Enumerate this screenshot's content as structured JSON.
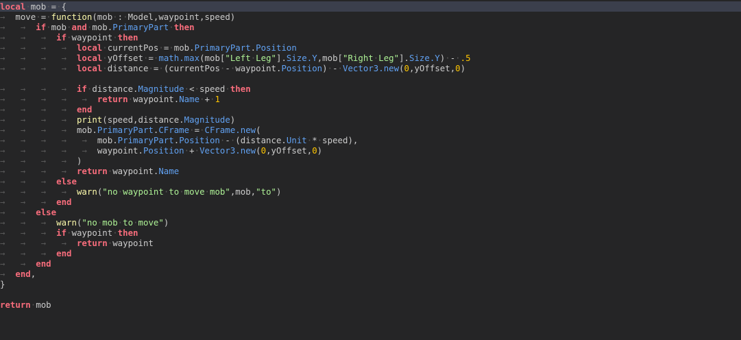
{
  "editor": {
    "lines": [
      [
        [
          "kw",
          "local"
        ],
        [
          "ws",
          "·"
        ],
        [
          "id",
          "mob"
        ],
        [
          "ws",
          "·"
        ],
        [
          "op",
          "="
        ],
        [
          "ws",
          "·"
        ],
        [
          "op",
          "{"
        ]
      ],
      [
        [
          "tab",
          "→"
        ],
        [
          "pad",
          "  "
        ],
        [
          "id",
          "move"
        ],
        [
          "ws",
          "·"
        ],
        [
          "op",
          "="
        ],
        [
          "ws",
          "·"
        ],
        [
          "fn",
          "function"
        ],
        [
          "op",
          "(mob"
        ],
        [
          "ws",
          "·"
        ],
        [
          "op",
          ":"
        ],
        [
          "ws",
          "·"
        ],
        [
          "id",
          "Model,waypoint,speed)"
        ]
      ],
      [
        [
          "tab",
          "→"
        ],
        [
          "pad",
          "   "
        ],
        [
          "tab",
          "→"
        ],
        [
          "pad",
          "  "
        ],
        [
          "kw",
          "if"
        ],
        [
          "ws",
          "·"
        ],
        [
          "id",
          "mob"
        ],
        [
          "ws",
          "·"
        ],
        [
          "kw",
          "and"
        ],
        [
          "ws",
          "·"
        ],
        [
          "id",
          "mob."
        ],
        [
          "prop",
          "PrimaryPart"
        ],
        [
          "ws",
          "·"
        ],
        [
          "kw",
          "then"
        ]
      ],
      [
        [
          "tab",
          "→"
        ],
        [
          "pad",
          "   "
        ],
        [
          "tab",
          "→"
        ],
        [
          "pad",
          "   "
        ],
        [
          "tab",
          "→"
        ],
        [
          "pad",
          "  "
        ],
        [
          "kw",
          "if"
        ],
        [
          "ws",
          "·"
        ],
        [
          "id",
          "waypoint"
        ],
        [
          "ws",
          "·"
        ],
        [
          "kw",
          "then"
        ]
      ],
      [
        [
          "tab",
          "→"
        ],
        [
          "pad",
          "   "
        ],
        [
          "tab",
          "→"
        ],
        [
          "pad",
          "   "
        ],
        [
          "tab",
          "→"
        ],
        [
          "pad",
          "   "
        ],
        [
          "tab",
          "→"
        ],
        [
          "pad",
          "  "
        ],
        [
          "kw",
          "local"
        ],
        [
          "ws",
          "·"
        ],
        [
          "id",
          "currentPos"
        ],
        [
          "ws",
          "·"
        ],
        [
          "op",
          "="
        ],
        [
          "ws",
          "·"
        ],
        [
          "id",
          "mob."
        ],
        [
          "prop",
          "PrimaryPart"
        ],
        [
          "id",
          "."
        ],
        [
          "prop",
          "Position"
        ]
      ],
      [
        [
          "tab",
          "→"
        ],
        [
          "pad",
          "   "
        ],
        [
          "tab",
          "→"
        ],
        [
          "pad",
          "   "
        ],
        [
          "tab",
          "→"
        ],
        [
          "pad",
          "   "
        ],
        [
          "tab",
          "→"
        ],
        [
          "pad",
          "  "
        ],
        [
          "kw",
          "local"
        ],
        [
          "ws",
          "·"
        ],
        [
          "id",
          "yOffset"
        ],
        [
          "ws",
          "·"
        ],
        [
          "op",
          "="
        ],
        [
          "ws",
          "·"
        ],
        [
          "prop",
          "math.max"
        ],
        [
          "id",
          "(mob["
        ],
        [
          "str",
          "\"Left"
        ],
        [
          "ws",
          "·"
        ],
        [
          "str",
          "Leg\""
        ],
        [
          "id",
          "]."
        ],
        [
          "prop",
          "Size.Y"
        ],
        [
          "id",
          ",mob["
        ],
        [
          "str",
          "\"Right"
        ],
        [
          "ws",
          "·"
        ],
        [
          "str",
          "Leg\""
        ],
        [
          "id",
          "]."
        ],
        [
          "prop",
          "Size.Y"
        ],
        [
          "id",
          ")"
        ],
        [
          "ws",
          "·"
        ],
        [
          "op",
          "-"
        ],
        [
          "ws",
          "·"
        ],
        [
          "num",
          ".5"
        ]
      ],
      [
        [
          "tab",
          "→"
        ],
        [
          "pad",
          "   "
        ],
        [
          "tab",
          "→"
        ],
        [
          "pad",
          "   "
        ],
        [
          "tab",
          "→"
        ],
        [
          "pad",
          "   "
        ],
        [
          "tab",
          "→"
        ],
        [
          "pad",
          "  "
        ],
        [
          "kw",
          "local"
        ],
        [
          "ws",
          "·"
        ],
        [
          "id",
          "distance"
        ],
        [
          "ws",
          "·"
        ],
        [
          "op",
          "="
        ],
        [
          "ws",
          "·"
        ],
        [
          "id",
          "(currentPos"
        ],
        [
          "ws",
          "·"
        ],
        [
          "op",
          "-"
        ],
        [
          "ws",
          "·"
        ],
        [
          "id",
          "waypoint."
        ],
        [
          "prop",
          "Position"
        ],
        [
          "id",
          ")"
        ],
        [
          "ws",
          "·"
        ],
        [
          "op",
          "-"
        ],
        [
          "ws",
          "·"
        ],
        [
          "prop",
          "Vector3.new"
        ],
        [
          "id",
          "("
        ],
        [
          "num",
          "0"
        ],
        [
          "id",
          ",yOffset,"
        ],
        [
          "num",
          "0"
        ],
        [
          "id",
          ")"
        ]
      ],
      [],
      [
        [
          "tab",
          "→"
        ],
        [
          "pad",
          "   "
        ],
        [
          "tab",
          "→"
        ],
        [
          "pad",
          "   "
        ],
        [
          "tab",
          "→"
        ],
        [
          "pad",
          "   "
        ],
        [
          "tab",
          "→"
        ],
        [
          "pad",
          "  "
        ],
        [
          "kw",
          "if"
        ],
        [
          "ws",
          "·"
        ],
        [
          "id",
          "distance."
        ],
        [
          "prop",
          "Magnitude"
        ],
        [
          "ws",
          "·"
        ],
        [
          "op",
          "<"
        ],
        [
          "ws",
          "·"
        ],
        [
          "id",
          "speed"
        ],
        [
          "ws",
          "·"
        ],
        [
          "kw",
          "then"
        ]
      ],
      [
        [
          "tab",
          "→"
        ],
        [
          "pad",
          "   "
        ],
        [
          "tab",
          "→"
        ],
        [
          "pad",
          "   "
        ],
        [
          "tab",
          "→"
        ],
        [
          "pad",
          "   "
        ],
        [
          "tab",
          "→"
        ],
        [
          "pad",
          "   "
        ],
        [
          "tab",
          "→"
        ],
        [
          "pad",
          "  "
        ],
        [
          "kw",
          "return"
        ],
        [
          "ws",
          "·"
        ],
        [
          "id",
          "waypoint."
        ],
        [
          "prop",
          "Name"
        ],
        [
          "ws",
          "·"
        ],
        [
          "op",
          "+"
        ],
        [
          "ws",
          "·"
        ],
        [
          "num",
          "1"
        ]
      ],
      [
        [
          "tab",
          "→"
        ],
        [
          "pad",
          "   "
        ],
        [
          "tab",
          "→"
        ],
        [
          "pad",
          "   "
        ],
        [
          "tab",
          "→"
        ],
        [
          "pad",
          "   "
        ],
        [
          "tab",
          "→"
        ],
        [
          "pad",
          "  "
        ],
        [
          "kw",
          "end"
        ]
      ],
      [
        [
          "tab",
          "→"
        ],
        [
          "pad",
          "   "
        ],
        [
          "tab",
          "→"
        ],
        [
          "pad",
          "   "
        ],
        [
          "tab",
          "→"
        ],
        [
          "pad",
          "   "
        ],
        [
          "tab",
          "→"
        ],
        [
          "pad",
          "  "
        ],
        [
          "fn",
          "print"
        ],
        [
          "id",
          "(speed,distance."
        ],
        [
          "prop",
          "Magnitude"
        ],
        [
          "id",
          ")"
        ]
      ],
      [
        [
          "tab",
          "→"
        ],
        [
          "pad",
          "   "
        ],
        [
          "tab",
          "→"
        ],
        [
          "pad",
          "   "
        ],
        [
          "tab",
          "→"
        ],
        [
          "pad",
          "   "
        ],
        [
          "tab",
          "→"
        ],
        [
          "pad",
          "  "
        ],
        [
          "id",
          "mob."
        ],
        [
          "prop",
          "PrimaryPart"
        ],
        [
          "id",
          "."
        ],
        [
          "prop",
          "CFrame"
        ],
        [
          "ws",
          "·"
        ],
        [
          "op",
          "="
        ],
        [
          "ws",
          "·"
        ],
        [
          "prop",
          "CFrame.new"
        ],
        [
          "id",
          "("
        ]
      ],
      [
        [
          "tab",
          "→"
        ],
        [
          "pad",
          "   "
        ],
        [
          "tab",
          "→"
        ],
        [
          "pad",
          "   "
        ],
        [
          "tab",
          "→"
        ],
        [
          "pad",
          "   "
        ],
        [
          "tab",
          "→"
        ],
        [
          "pad",
          "   "
        ],
        [
          "tab",
          "→"
        ],
        [
          "pad",
          "  "
        ],
        [
          "id",
          "mob."
        ],
        [
          "prop",
          "PrimaryPart"
        ],
        [
          "id",
          "."
        ],
        [
          "prop",
          "Position"
        ],
        [
          "ws",
          "·"
        ],
        [
          "op",
          "-"
        ],
        [
          "ws",
          "·"
        ],
        [
          "id",
          "(distance."
        ],
        [
          "prop",
          "Unit"
        ],
        [
          "ws",
          "·"
        ],
        [
          "op",
          "*"
        ],
        [
          "ws",
          "·"
        ],
        [
          "id",
          "speed),"
        ]
      ],
      [
        [
          "tab",
          "→"
        ],
        [
          "pad",
          "   "
        ],
        [
          "tab",
          "→"
        ],
        [
          "pad",
          "   "
        ],
        [
          "tab",
          "→"
        ],
        [
          "pad",
          "   "
        ],
        [
          "tab",
          "→"
        ],
        [
          "pad",
          "   "
        ],
        [
          "tab",
          "→"
        ],
        [
          "pad",
          "  "
        ],
        [
          "id",
          "waypoint."
        ],
        [
          "prop",
          "Position"
        ],
        [
          "ws",
          "·"
        ],
        [
          "op",
          "+"
        ],
        [
          "ws",
          "·"
        ],
        [
          "prop",
          "Vector3.new"
        ],
        [
          "id",
          "("
        ],
        [
          "num",
          "0"
        ],
        [
          "id",
          ",yOffset,"
        ],
        [
          "num",
          "0"
        ],
        [
          "id",
          ")"
        ]
      ],
      [
        [
          "tab",
          "→"
        ],
        [
          "pad",
          "   "
        ],
        [
          "tab",
          "→"
        ],
        [
          "pad",
          "   "
        ],
        [
          "tab",
          "→"
        ],
        [
          "pad",
          "   "
        ],
        [
          "tab",
          "→"
        ],
        [
          "pad",
          "  "
        ],
        [
          "id",
          ")"
        ]
      ],
      [
        [
          "tab",
          "→"
        ],
        [
          "pad",
          "   "
        ],
        [
          "tab",
          "→"
        ],
        [
          "pad",
          "   "
        ],
        [
          "tab",
          "→"
        ],
        [
          "pad",
          "   "
        ],
        [
          "tab",
          "→"
        ],
        [
          "pad",
          "  "
        ],
        [
          "kw",
          "return"
        ],
        [
          "ws",
          "·"
        ],
        [
          "id",
          "waypoint."
        ],
        [
          "prop",
          "Name"
        ]
      ],
      [
        [
          "tab",
          "→"
        ],
        [
          "pad",
          "   "
        ],
        [
          "tab",
          "→"
        ],
        [
          "pad",
          "   "
        ],
        [
          "tab",
          "→"
        ],
        [
          "pad",
          "  "
        ],
        [
          "kw",
          "else"
        ]
      ],
      [
        [
          "tab",
          "→"
        ],
        [
          "pad",
          "   "
        ],
        [
          "tab",
          "→"
        ],
        [
          "pad",
          "   "
        ],
        [
          "tab",
          "→"
        ],
        [
          "pad",
          "   "
        ],
        [
          "tab",
          "→"
        ],
        [
          "pad",
          "  "
        ],
        [
          "fn",
          "warn"
        ],
        [
          "id",
          "("
        ],
        [
          "str",
          "\"no"
        ],
        [
          "ws",
          "·"
        ],
        [
          "str",
          "waypoint"
        ],
        [
          "ws",
          "·"
        ],
        [
          "str",
          "to"
        ],
        [
          "ws",
          "·"
        ],
        [
          "str",
          "move"
        ],
        [
          "ws",
          "·"
        ],
        [
          "str",
          "mob\""
        ],
        [
          "id",
          ",mob,"
        ],
        [
          "str",
          "\"to\""
        ],
        [
          "id",
          ")"
        ]
      ],
      [
        [
          "tab",
          "→"
        ],
        [
          "pad",
          "   "
        ],
        [
          "tab",
          "→"
        ],
        [
          "pad",
          "   "
        ],
        [
          "tab",
          "→"
        ],
        [
          "pad",
          "  "
        ],
        [
          "kw",
          "end"
        ]
      ],
      [
        [
          "tab",
          "→"
        ],
        [
          "pad",
          "   "
        ],
        [
          "tab",
          "→"
        ],
        [
          "pad",
          "  "
        ],
        [
          "kw",
          "else"
        ]
      ],
      [
        [
          "tab",
          "→"
        ],
        [
          "pad",
          "   "
        ],
        [
          "tab",
          "→"
        ],
        [
          "pad",
          "   "
        ],
        [
          "tab",
          "→"
        ],
        [
          "pad",
          "  "
        ],
        [
          "fn",
          "warn"
        ],
        [
          "id",
          "("
        ],
        [
          "str",
          "\"no"
        ],
        [
          "ws",
          "·"
        ],
        [
          "str",
          "mob"
        ],
        [
          "ws",
          "·"
        ],
        [
          "str",
          "to"
        ],
        [
          "ws",
          "·"
        ],
        [
          "str",
          "move\""
        ],
        [
          "id",
          ")"
        ]
      ],
      [
        [
          "tab",
          "→"
        ],
        [
          "pad",
          "   "
        ],
        [
          "tab",
          "→"
        ],
        [
          "pad",
          "   "
        ],
        [
          "tab",
          "→"
        ],
        [
          "pad",
          "  "
        ],
        [
          "kw",
          "if"
        ],
        [
          "ws",
          "·"
        ],
        [
          "id",
          "waypoint"
        ],
        [
          "ws",
          "·"
        ],
        [
          "kw",
          "then"
        ]
      ],
      [
        [
          "tab",
          "→"
        ],
        [
          "pad",
          "   "
        ],
        [
          "tab",
          "→"
        ],
        [
          "pad",
          "   "
        ],
        [
          "tab",
          "→"
        ],
        [
          "pad",
          "   "
        ],
        [
          "tab",
          "→"
        ],
        [
          "pad",
          "  "
        ],
        [
          "kw",
          "return"
        ],
        [
          "ws",
          "·"
        ],
        [
          "id",
          "waypoint"
        ]
      ],
      [
        [
          "tab",
          "→"
        ],
        [
          "pad",
          "   "
        ],
        [
          "tab",
          "→"
        ],
        [
          "pad",
          "   "
        ],
        [
          "tab",
          "→"
        ],
        [
          "pad",
          "  "
        ],
        [
          "kw",
          "end"
        ]
      ],
      [
        [
          "tab",
          "→"
        ],
        [
          "pad",
          "   "
        ],
        [
          "tab",
          "→"
        ],
        [
          "pad",
          "  "
        ],
        [
          "kw",
          "end"
        ]
      ],
      [
        [
          "tab",
          "→"
        ],
        [
          "pad",
          "  "
        ],
        [
          "kw",
          "end"
        ],
        [
          "id",
          ","
        ]
      ],
      [
        [
          "op",
          "}"
        ]
      ],
      [],
      [
        [
          "kw",
          "return"
        ],
        [
          "ws",
          "·"
        ],
        [
          "id",
          "mob"
        ]
      ]
    ]
  }
}
